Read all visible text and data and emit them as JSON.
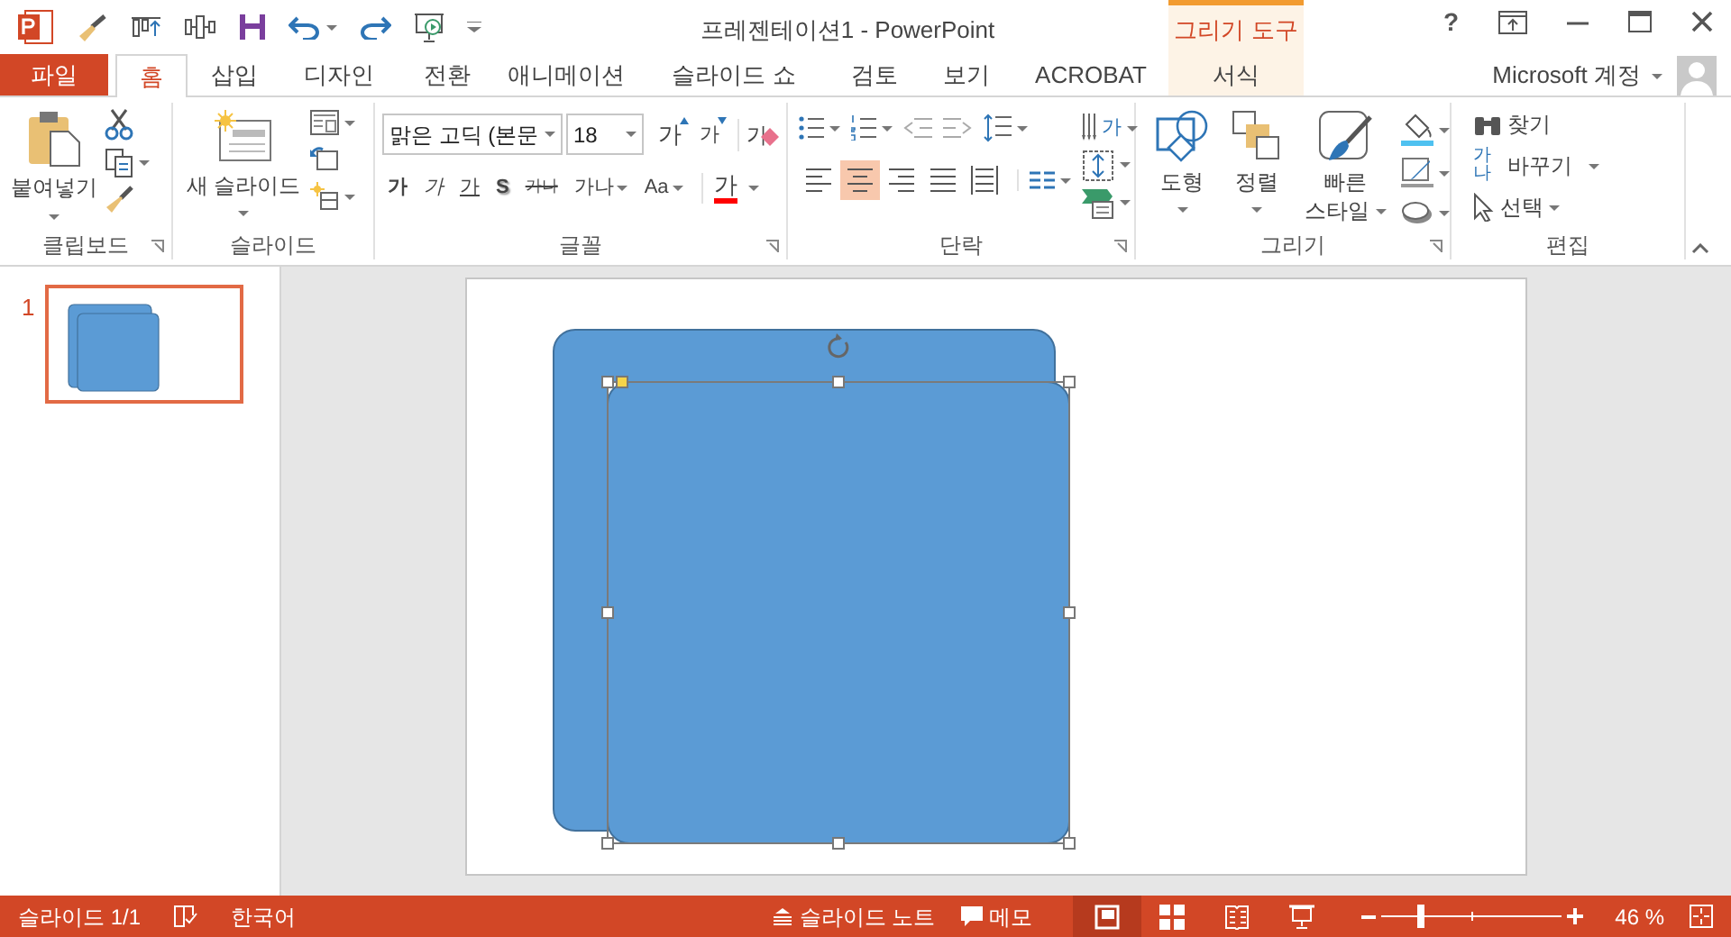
{
  "title_bar": {
    "title": "프레젠테이션1 - PowerPoint",
    "contextual_group": "그리기 도구",
    "help": "?"
  },
  "tabs": [
    {
      "label": "파일",
      "kind": "file",
      "selected": false
    },
    {
      "label": "홈",
      "kind": "normal",
      "selected": true
    },
    {
      "label": "삽입",
      "kind": "normal",
      "selected": false
    },
    {
      "label": "디자인",
      "kind": "normal",
      "selected": false
    },
    {
      "label": "전환",
      "kind": "normal",
      "selected": false
    },
    {
      "label": "애니메이션",
      "kind": "normal",
      "selected": false
    },
    {
      "label": "슬라이드 쇼",
      "kind": "normal",
      "selected": false
    },
    {
      "label": "검토",
      "kind": "normal",
      "selected": false
    },
    {
      "label": "보기",
      "kind": "normal",
      "selected": false
    },
    {
      "label": "ACROBAT",
      "kind": "normal",
      "selected": false
    },
    {
      "label": "서식",
      "kind": "contextual",
      "selected": false
    }
  ],
  "account": {
    "label": "Microsoft 계정"
  },
  "ribbon": {
    "clipboard": {
      "label": "클립보드",
      "paste": "붙여넣기"
    },
    "slides": {
      "label": "슬라이드",
      "new_slide": "새 슬라이드"
    },
    "font": {
      "label": "글꼴",
      "font_name": "맑은 고딕 (본문",
      "font_size": "18",
      "grow": "가",
      "shrink": "가",
      "clear": "가",
      "styles": [
        {
          "label": "가",
          "kind": "bold"
        },
        {
          "label": "가",
          "kind": "italic"
        },
        {
          "label": "가",
          "kind": "underline"
        },
        {
          "label": "S",
          "kind": "shadow"
        },
        {
          "label": "가나",
          "kind": "strike"
        },
        {
          "label": "가나",
          "kind": "spacing"
        },
        {
          "label": "Aa",
          "kind": "case"
        }
      ],
      "color_button": "가"
    },
    "paragraph": {
      "label": "단락",
      "text_direction": "가",
      "alignment": [
        {
          "kind": "left",
          "selected": false
        },
        {
          "kind": "center",
          "selected": true
        },
        {
          "kind": "right",
          "selected": false
        },
        {
          "kind": "justify",
          "selected": false
        },
        {
          "kind": "distributed",
          "selected": false
        }
      ]
    },
    "drawing": {
      "label": "그리기",
      "shapes": "도형",
      "arrange": "정렬",
      "quick_styles": "빠른 스타일"
    },
    "editing": {
      "label": "편집",
      "find": "찾기",
      "replace_icon": "가나",
      "replace": "바꾸기",
      "select": "선택"
    }
  },
  "thumbnails": [
    {
      "number": "1",
      "selected": true
    }
  ],
  "slide": {
    "shapes": [
      {
        "kind": "rounded_rectangle",
        "selected": false
      },
      {
        "kind": "rounded_rectangle",
        "selected": true
      }
    ]
  },
  "status_bar": {
    "slide_counter": "슬라이드 1/1",
    "language": "한국어",
    "notes": "슬라이드 노트",
    "comments": "메모",
    "views": [
      {
        "kind": "normal",
        "selected": true
      },
      {
        "kind": "sorter",
        "selected": false
      },
      {
        "kind": "reading",
        "selected": false
      },
      {
        "kind": "slideshow",
        "selected": false
      }
    ],
    "zoom": {
      "level": 0.22,
      "reading": "46 %"
    }
  }
}
